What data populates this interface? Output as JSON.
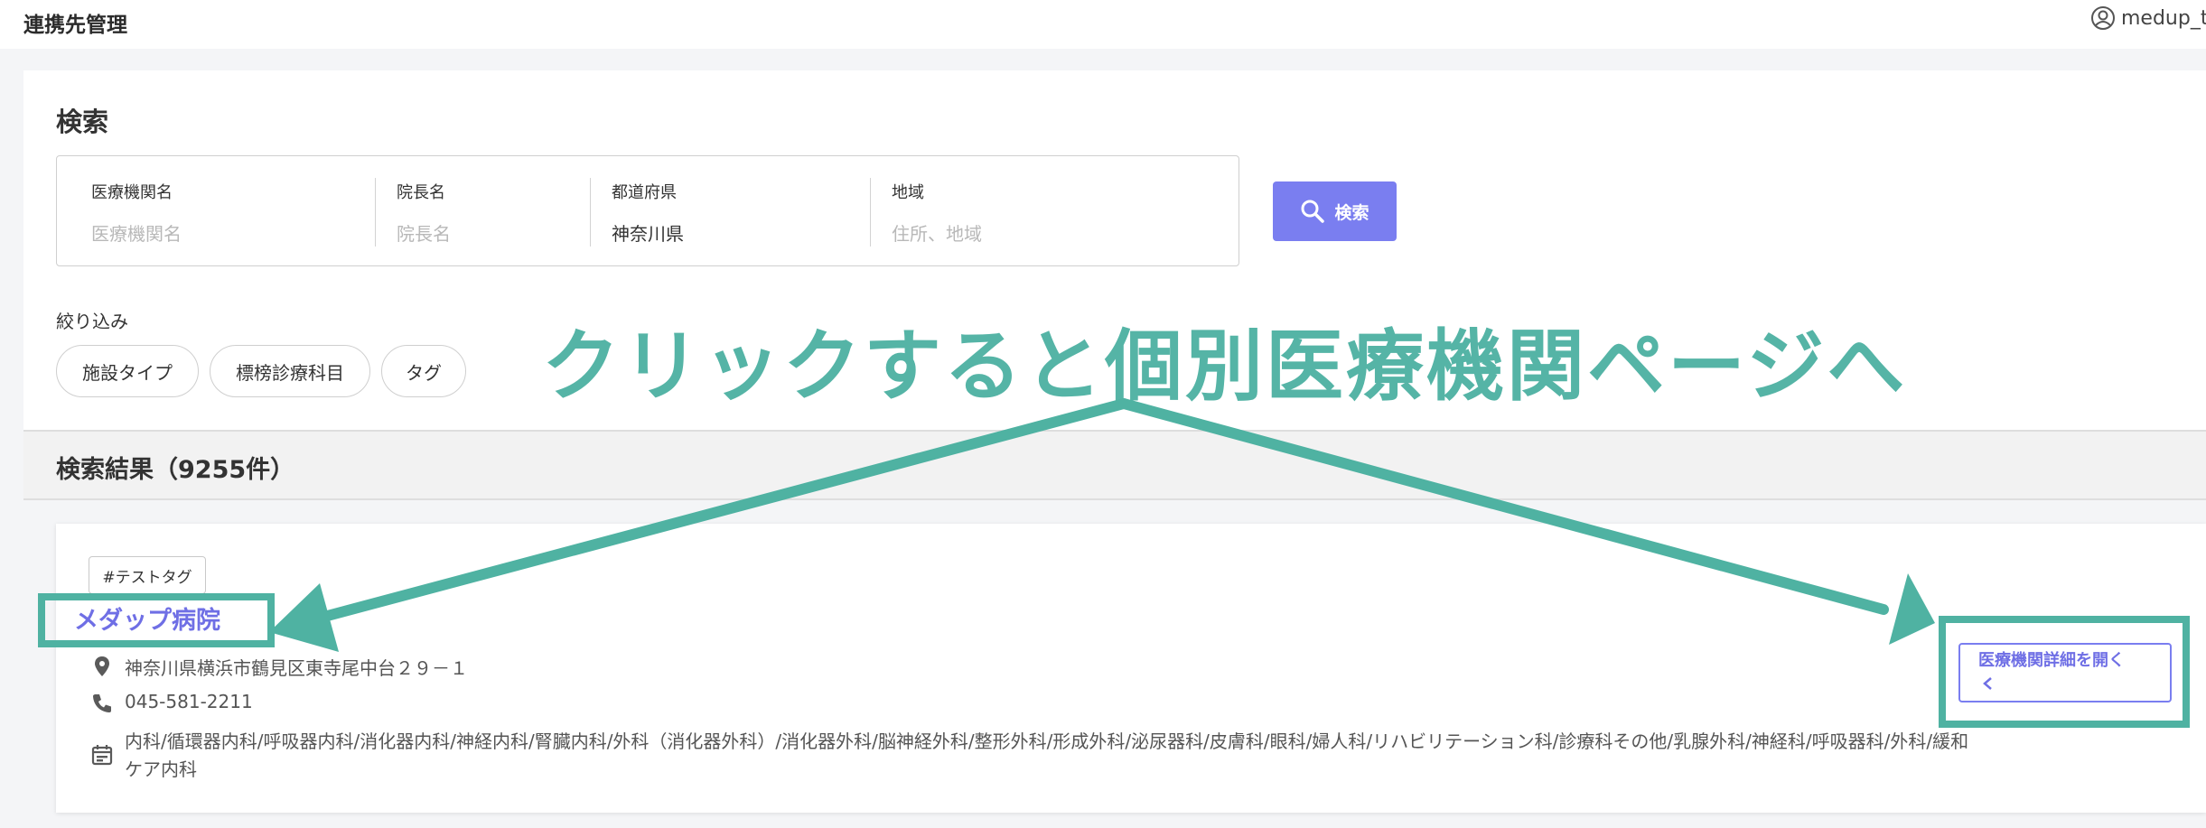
{
  "header": {
    "title": "連携先管理",
    "user": "medup_t"
  },
  "search": {
    "title": "検索",
    "fields": [
      {
        "label": "医療機関名",
        "value": "",
        "placeholder": "医療機関名"
      },
      {
        "label": "院長名",
        "value": "",
        "placeholder": "院長名"
      },
      {
        "label": "都道府県",
        "value": "神奈川県",
        "placeholder": ""
      },
      {
        "label": "地域",
        "value": "",
        "placeholder": "住所、地域"
      }
    ],
    "button_label": "検索"
  },
  "filters": {
    "label": "絞り込み",
    "chips": [
      "施設タイプ",
      "標榜診療科目",
      "タグ"
    ]
  },
  "results": {
    "title": "検索結果（9255件）",
    "items": [
      {
        "tag": "#テストタグ",
        "name": "メダップ病院",
        "address": "神奈川県横浜市鶴見区東寺尾中台２９－１",
        "phone": "045-581-2211",
        "departments": "内科/循環器内科/呼吸器内科/消化器内科/神経内科/腎臓内科/外科（消化器外科）/消化器外科/脳神経外科/整形外科/形成外科/泌尿器科/皮膚科/眼科/婦人科/リハビリテーション科/診療科その他/乳腺外科/神経科/呼吸器科/外科/緩和ケア内科",
        "detail_button": "医療機関詳細を開く"
      }
    ]
  },
  "annotation": {
    "text": "クリックすると個別医療機関ページへ",
    "color": "#4fb2a2"
  },
  "colors": {
    "accent": "#7a7ef0",
    "link": "#6f6fe5"
  }
}
